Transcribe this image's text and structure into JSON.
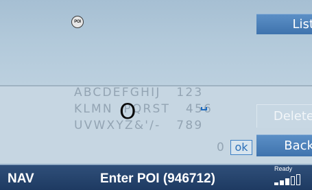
{
  "status_bar": {
    "mode": "NAV",
    "title": "Enter POI (946712)",
    "gps_status": "Ready"
  },
  "input": {
    "poi_icon_text": "POI",
    "current_text": ""
  },
  "speller": {
    "rows": [
      "ABCDEFGHIJ   123",
      "KLMNOPQRST   456",
      "UVWXYZ&'/-   789"
    ],
    "selected_char": "O",
    "space_symbol": "␣",
    "zero": "0",
    "ok_label": "ok"
  },
  "softkeys": {
    "list": "List",
    "delete": "Delete",
    "back": "Back"
  },
  "colors": {
    "accent": "#4a7fb8",
    "status_bar": "#254470",
    "speller_background": "#c6d6e2"
  },
  "icons": {
    "poi": "poi-icon",
    "signal": "signal-strength-icon"
  },
  "signal_level": 3
}
